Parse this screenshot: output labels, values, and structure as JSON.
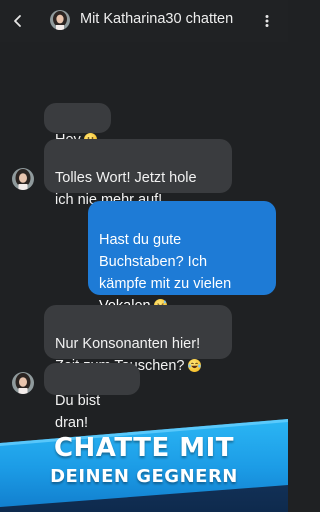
{
  "header": {
    "title": "Mit Katharina30 chatten",
    "back_icon": "chevron-left-icon",
    "more_icon": "more-vertical-icon"
  },
  "messages": [
    {
      "sender": "contact",
      "text": "Hey",
      "emoji": "smiling-face-emoji"
    },
    {
      "sender": "contact",
      "text": "Tolles Wort! Jetzt hole\nich nie mehr auf!"
    },
    {
      "sender": "me",
      "text": "Hast du gute\nBuchstaben? Ich\nkämpfe mit zu vielen\nVokalen",
      "emoji": "grinning-sweat-emoji"
    },
    {
      "sender": "contact",
      "text": "Nur Konsonanten hier!\nZeit zum Tauschen?",
      "emoji": "laughing-tears-emoji"
    },
    {
      "sender": "contact",
      "text": "Du bist dran!"
    }
  ],
  "banner": {
    "line1": "CHATTE MIT",
    "line2": "DEINEN GEGNERN"
  },
  "colors": {
    "background": "#1f2123",
    "incoming_bubble": "#3a3c3f",
    "outgoing_bubble": "#1e7bd6",
    "banner_blue": "#1c9ce6",
    "banner_dark": "#14355f"
  }
}
